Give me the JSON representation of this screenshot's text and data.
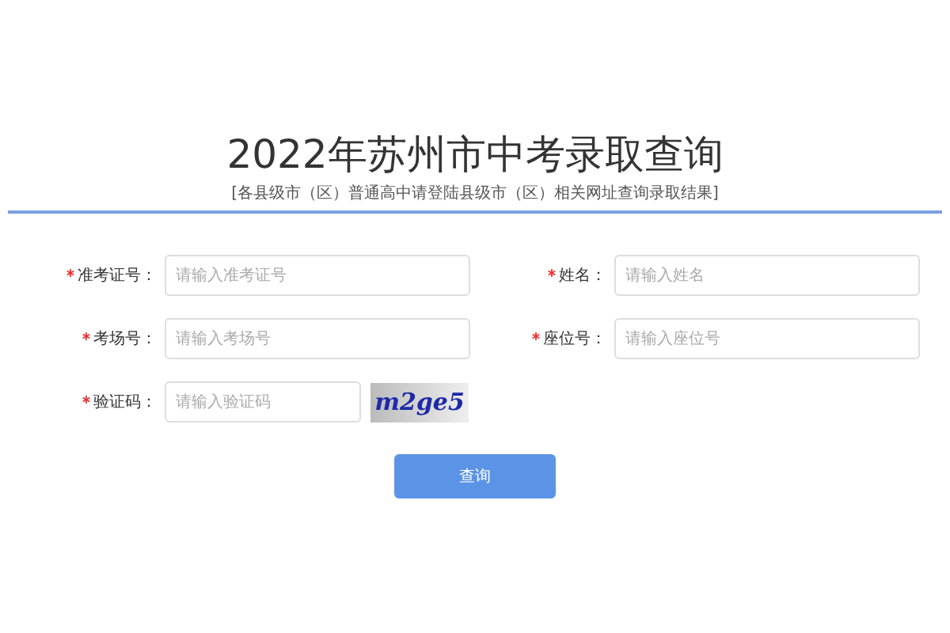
{
  "title": "2022年苏州市中考录取查询",
  "subtitle": "[各县级市（区）普通高中请登陆县级市（区）相关网址查询录取结果]",
  "fields": [
    {
      "label": "准考证号：",
      "placeholder": "请输入准考证号",
      "required": true
    },
    {
      "label": "姓名：",
      "placeholder": "请输入姓名",
      "required": true
    },
    {
      "label": "考场号：",
      "placeholder": "请输入考场号",
      "required": true
    },
    {
      "label": "座位号：",
      "placeholder": "请输入座位号",
      "required": true
    }
  ],
  "captcha": {
    "label": "验证码：",
    "placeholder": "请输入验证码",
    "required": true,
    "code": "m2ge5"
  },
  "button": "查询"
}
